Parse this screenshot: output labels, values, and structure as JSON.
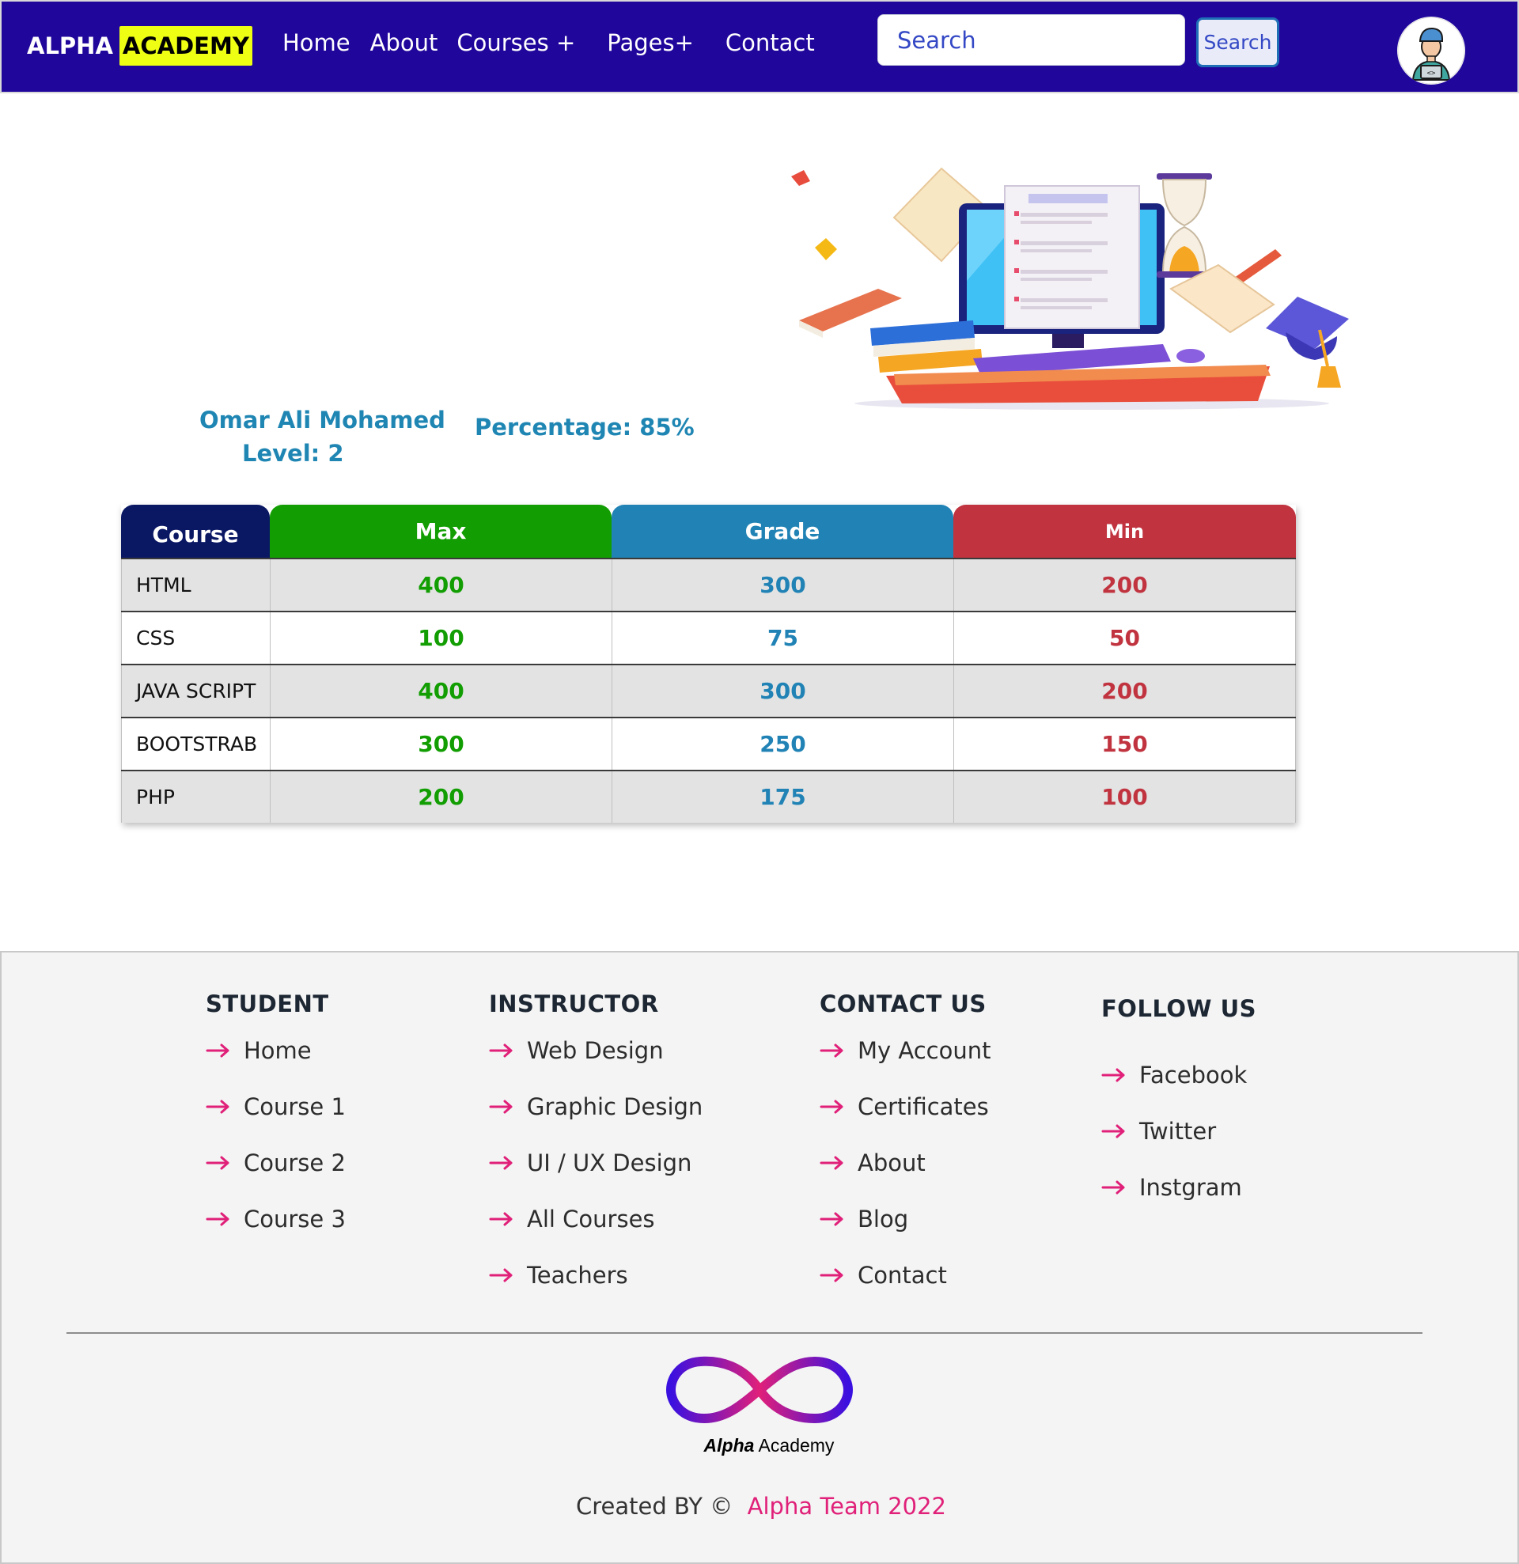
{
  "navbar": {
    "brand_first": "ALPHA",
    "brand_second": "ACADEMY",
    "links": [
      "Home",
      "About",
      "Courses +",
      "Pages+",
      "Contact"
    ],
    "search_placeholder": "Search",
    "search_button": "Search",
    "colors": {
      "bar": "#21069c",
      "brand_highlight": "#eeff14"
    },
    "avatar_icon": "developer-avatar-icon"
  },
  "student": {
    "name": "Omar Ali Mohamed",
    "level": "Level: 2",
    "percentage": "Percentage: 85%"
  },
  "grades": {
    "headers": [
      "Course",
      "Max",
      "Grade",
      "Min"
    ],
    "rows": [
      {
        "course": "HTML",
        "max": "400",
        "grade": "300",
        "min": "200"
      },
      {
        "course": "CSS",
        "max": "100",
        "grade": "75",
        "min": "50"
      },
      {
        "course": "JAVA SCRIPT",
        "max": "400",
        "grade": "300",
        "min": "200"
      },
      {
        "course": "BOOTSTRAB",
        "max": "300",
        "grade": "250",
        "min": "150"
      },
      {
        "course": "PHP",
        "max": "200",
        "grade": "175",
        "min": "100"
      }
    ],
    "colors": {
      "course": "#0a1864",
      "max": "#129e03",
      "grade": "#2183b5",
      "min": "#c0333f"
    }
  },
  "footer": {
    "columns": [
      {
        "heading": "STUDENT",
        "items": [
          "Home",
          "Course 1",
          "Course 2",
          "Course 3"
        ]
      },
      {
        "heading": "INSTRUCTOR",
        "items": [
          "Web Design",
          "Graphic Design",
          "UI / UX Design",
          "All Courses",
          "Teachers"
        ]
      },
      {
        "heading": "CONTACT US",
        "items": [
          "My Account",
          "Certificates",
          "About",
          "Blog",
          "Contact"
        ]
      },
      {
        "heading": "FOLLOW US",
        "items": [
          "Facebook",
          "Twitter",
          "Instgram"
        ]
      }
    ],
    "logo_text_bold": "Alpha",
    "logo_text_rest": " Academy",
    "credit_prefix": "Created BY ©",
    "credit_team": "Alpha Team 2022",
    "arrow_icon": "arrow-right-icon",
    "arrow_color": "#e02079"
  }
}
